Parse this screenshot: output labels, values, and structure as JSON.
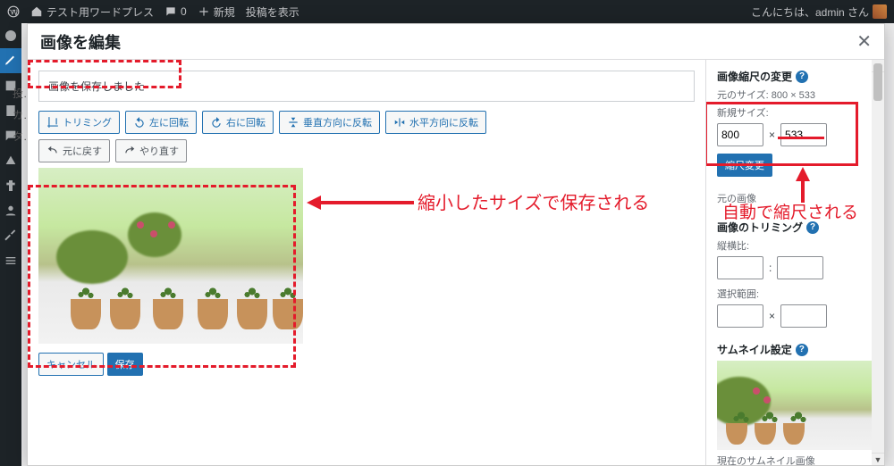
{
  "adminbar": {
    "site_name": "テスト用ワードプレス",
    "comments": "0",
    "new_label": "新規",
    "view_post": "投稿を表示",
    "greeting": "こんにちは、admin さん"
  },
  "modal": {
    "title": "画像を編集",
    "close_glyph": "✕",
    "notice": "画像を保存しました"
  },
  "toolbar": {
    "crop": "トリミング",
    "rotate_left": "左に回転",
    "rotate_right": "右に回転",
    "flip_v": "垂直方向に反転",
    "flip_h": "水平方向に反転",
    "undo": "元に戻す",
    "redo": "やり直す"
  },
  "footer": {
    "cancel": "キャンセル",
    "save": "保存"
  },
  "side": {
    "scale": {
      "heading": "画像縮尺の変更",
      "original_prefix": "元のサイズ:",
      "original_value": "800 × 533",
      "new_size_label": "新規サイズ:",
      "width": "800",
      "height": "533",
      "sep": "×",
      "apply": "縮尺変更"
    },
    "restore": {
      "text": "元の画像"
    },
    "crop": {
      "heading": "画像のトリミング",
      "aspect_label": "縦横比:",
      "sep": ":",
      "selection_label": "選択範囲:",
      "sep2": "×"
    },
    "thumb": {
      "heading": "サムネイル設定",
      "caption": "現在のサムネイル画像"
    }
  },
  "annotations": {
    "main_text": "縮小したサイズで保存される",
    "side_text": "自動で縮尺される"
  },
  "background_hints": {
    "post": "投…",
    "ca": "カ…",
    "ta": "タ…"
  }
}
